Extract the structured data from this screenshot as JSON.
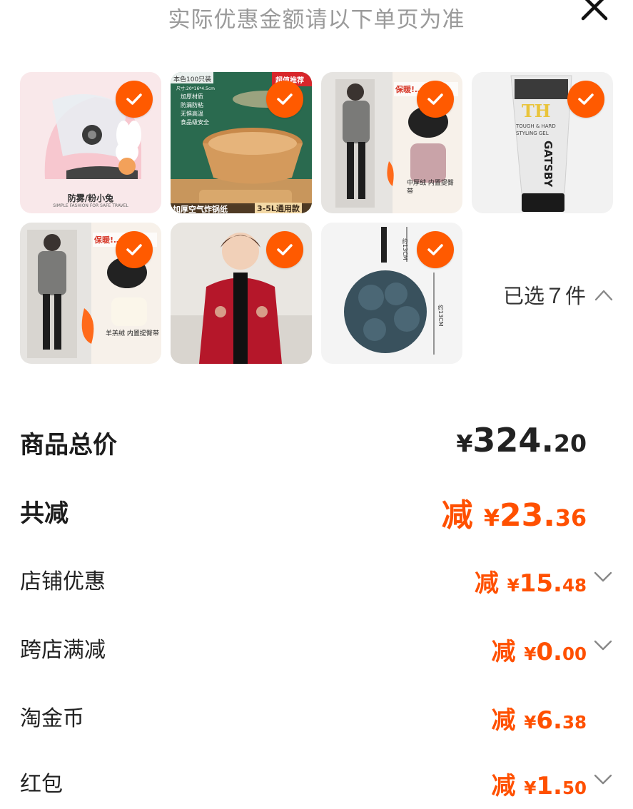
{
  "header": {
    "note": "实际优惠金额请以下单页为准"
  },
  "products": [
    {
      "caption": "防雾/粉小兔",
      "sub": "SIMPLE FASHION FOR SAFE TRAVEL",
      "icon": "helmet-image",
      "selected": true
    },
    {
      "tag": "超值推荐",
      "box_label": "本色100只装",
      "spec": "尺寸:20*16*4.5cm",
      "points": [
        "加厚材质",
        "防漏防粘",
        "无惧高温",
        "食品级安全"
      ],
      "caption": "加厚空气炸锅纸",
      "badge": "3-5L通用款",
      "icon": "air-fryer-paper-image",
      "selected": true
    },
    {
      "banner": "保暖!…",
      "text": "中厚绒 内置提臀带",
      "icon": "leggings-image",
      "selected": true
    },
    {
      "brand": "GATSBY",
      "logo": "TH",
      "line1": "TOUGH & HARD",
      "line2": "STYLING GEL",
      "icon": "hair-gel-image",
      "selected": true
    },
    {
      "banner": "保暖!…",
      "text": "羊羔绒 内置提臀带",
      "icon": "fleece-leggings-image",
      "selected": true
    },
    {
      "icon": "cardigan-image",
      "selected": true
    },
    {
      "dim1": "约13CM",
      "dim2": "约13CM",
      "icon": "bath-sponge-image",
      "selected": true
    }
  ],
  "selection": {
    "label": "已选７件"
  },
  "summary": {
    "total": {
      "label": "商品总价",
      "yen": "¥",
      "int": "324.",
      "dec": "20"
    },
    "reduce": {
      "label": "共减",
      "prefix": "减 ",
      "yen": "¥",
      "int": "23.",
      "dec": "36"
    },
    "items": [
      {
        "label": "店铺优惠",
        "prefix": "减 ",
        "yen": "¥",
        "int": "15.",
        "dec": "48",
        "expandable": true
      },
      {
        "label": "跨店满减",
        "prefix": "减 ",
        "yen": "¥",
        "int": "0.",
        "dec": "00",
        "expandable": true
      },
      {
        "label": "淘金币",
        "prefix": "减 ",
        "yen": "¥",
        "int": "6.",
        "dec": "38",
        "expandable": false
      },
      {
        "label": "红包",
        "prefix": "减 ",
        "yen": "¥",
        "int": "1.",
        "dec": "50",
        "expandable": true
      }
    ]
  },
  "colors": {
    "accent": "#ff5000",
    "check": "#ff5a00",
    "muted": "#9a9a9a"
  }
}
